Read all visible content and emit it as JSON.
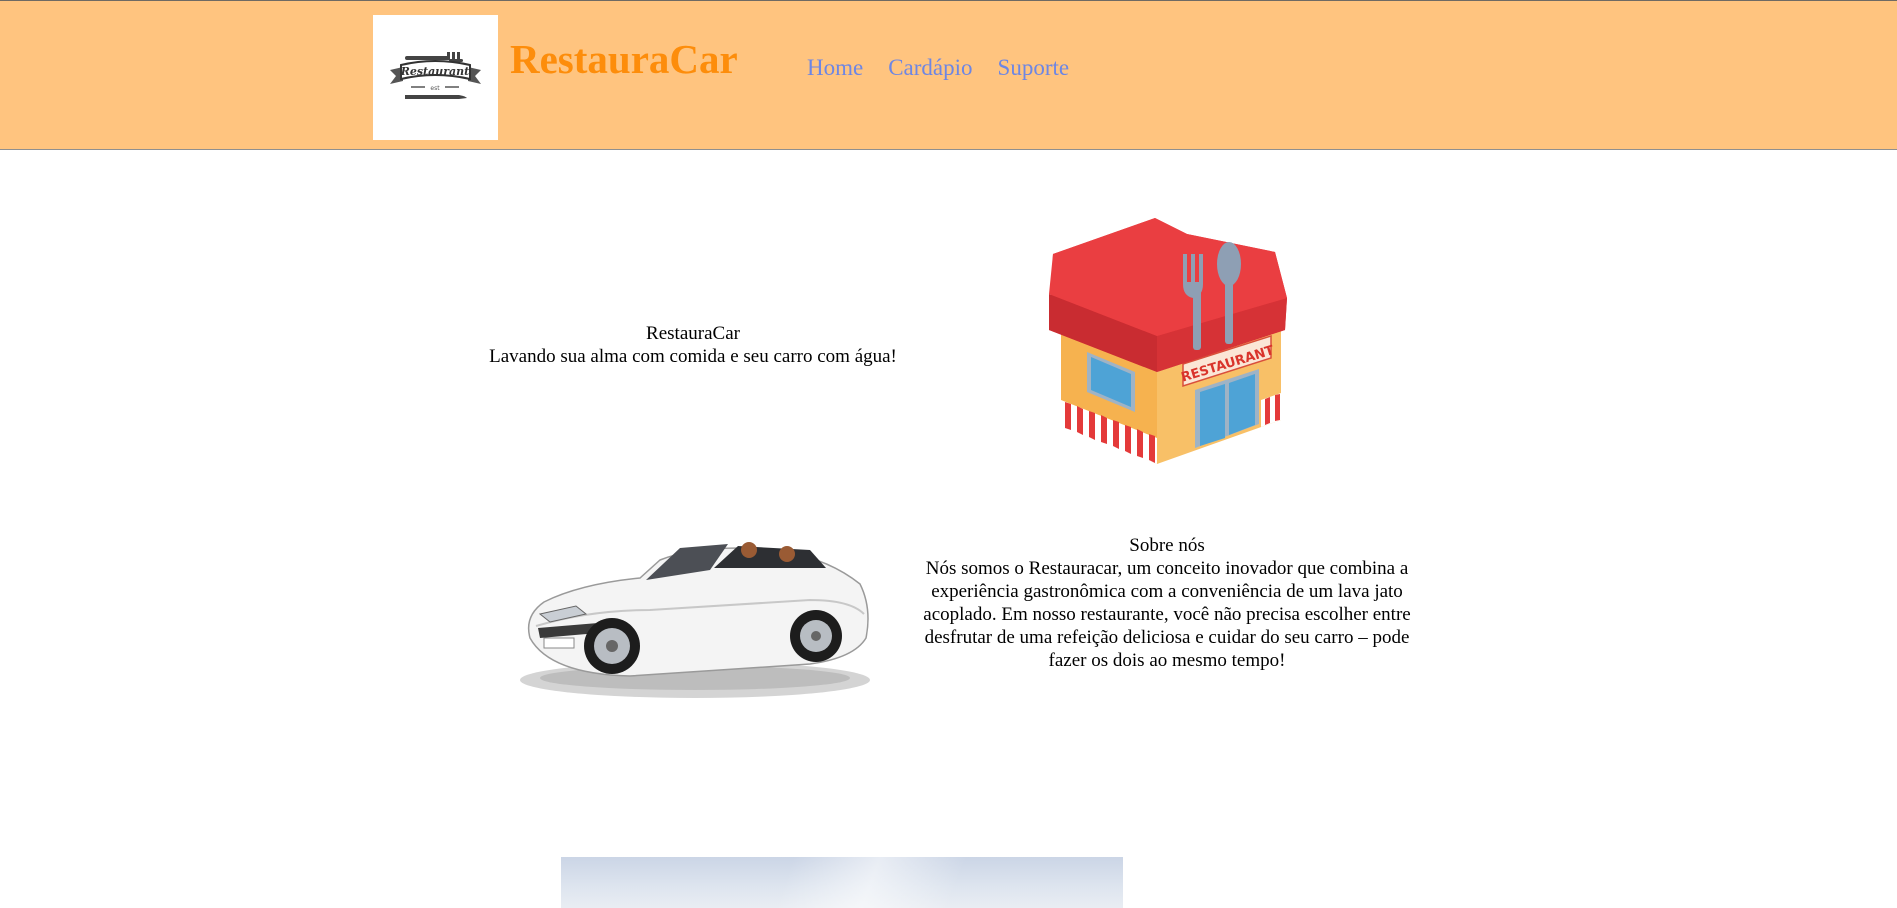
{
  "header": {
    "brand": "RestauraCar",
    "logo": {
      "icon": "restaurant-logo-icon",
      "text": "Restaurant"
    },
    "nav": [
      {
        "label": "Home"
      },
      {
        "label": "Cardápio"
      },
      {
        "label": "Suporte"
      }
    ],
    "colors": {
      "background": "#ffc47f",
      "brand": "#fd8d0b",
      "nav_link": "#6d86e4"
    }
  },
  "hero": {
    "title": "RestauraCar",
    "tagline": "Lavando sua alma com comida e seu carro com água!",
    "image": {
      "icon": "restaurant-building-icon",
      "sign_text": "RESTAURANT"
    }
  },
  "about": {
    "image": {
      "icon": "convertible-car-icon"
    },
    "title": "Sobre nós",
    "body": "Nós somos o Restauracar, um conceito inovador que combina a experiência gastronômica com a conveniência de um lava jato acoplado. Em nosso restaurante, você não precisa escolher entre desfrutar de uma refeição deliciosa e cuidar do seu carro – pode fazer os dois ao mesmo tempo!"
  },
  "bottom": {
    "image": {
      "icon": "landscape-photo-icon"
    }
  }
}
